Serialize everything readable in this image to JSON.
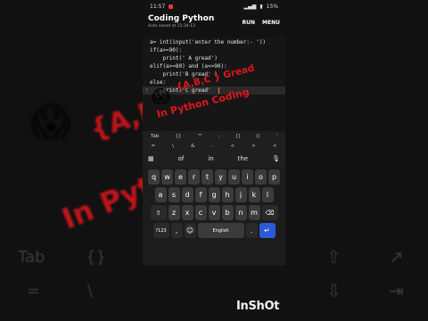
{
  "status": {
    "time": "11:57",
    "battery": "15%"
  },
  "app": {
    "title": "Coding Python",
    "subtitle": "Auto saved at 11:34:13",
    "run_label": "RUN",
    "menu_label": "MENU"
  },
  "code": {
    "lines": [
      {
        "num": "",
        "text": "a= int(input('enter the number:- '))"
      },
      {
        "num": "",
        "text": "if(a>=90):"
      },
      {
        "num": "",
        "text": "    print(' A gread')"
      },
      {
        "num": "",
        "text": "elif(a>=80) and (a<=90):"
      },
      {
        "num": "",
        "text": "    print('B gread' )"
      },
      {
        "num": "",
        "text": "else:"
      },
      {
        "num": "7",
        "text": "    print('C gread'  "
      }
    ]
  },
  "overlay": {
    "line1": "{A,B,C } Gread",
    "line2": "In Python Coding",
    "bg_line1": "{A,B,C } Gread",
    "bg_line2": "In Python Coding"
  },
  "symbol_bar": {
    "row1": [
      "Tab",
      "{}",
      "\"\"",
      ":",
      "[]",
      "()",
      "'"
    ],
    "row2": [
      "=",
      "\\",
      "&",
      "-",
      "<",
      ">",
      "<"
    ]
  },
  "background_keys": {
    "left": [
      "Tab",
      "{}",
      "=",
      "\\"
    ]
  },
  "suggestions": [
    "of",
    "in",
    "the"
  ],
  "keyboard": {
    "row1": [
      "q",
      "w",
      "e",
      "r",
      "t",
      "y",
      "u",
      "i",
      "o",
      "p"
    ],
    "row2": [
      "a",
      "s",
      "d",
      "f",
      "g",
      "h",
      "j",
      "k",
      "l"
    ],
    "row3": [
      "z",
      "x",
      "c",
      "v",
      "b",
      "n",
      "m"
    ],
    "row4": {
      "numbers": "?123",
      "comma": ",",
      "space": "English",
      "period": "."
    }
  },
  "watermark": "InShOt"
}
